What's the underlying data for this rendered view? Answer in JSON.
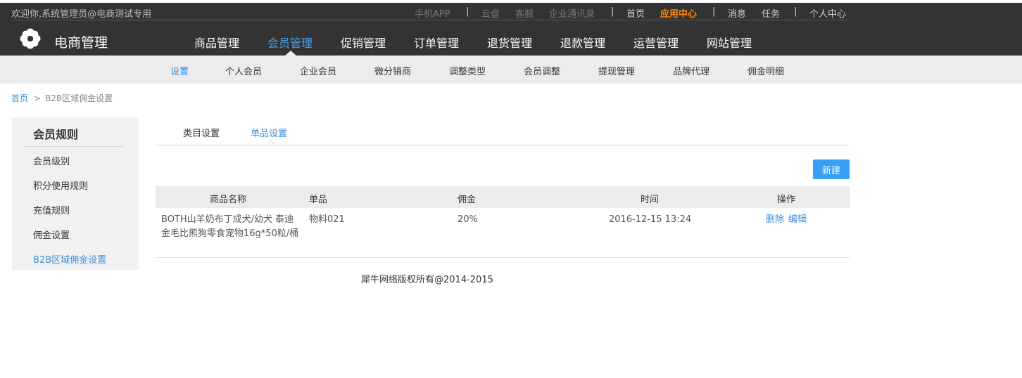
{
  "topbar": {
    "welcome": "欢迎你,系统管理员@电商测试专用",
    "links": {
      "app": "手机APP",
      "cloud": "云盘",
      "customer_service": "客服",
      "directory": "企业通讯录",
      "home": "首页",
      "app_center": "应用中心",
      "messages": "消息",
      "tasks": "任务",
      "profile": "个人中心"
    },
    "separator": "|"
  },
  "brand": {
    "name": "电商管理"
  },
  "main_nav": {
    "items": [
      "商品管理",
      "会员管理",
      "促销管理",
      "订单管理",
      "退货管理",
      "退款管理",
      "运营管理",
      "网站管理"
    ],
    "active": "会员管理"
  },
  "sub_nav": {
    "items": [
      "设置",
      "个人会员",
      "企业会员",
      "微分销商",
      "调整类型",
      "会员调整",
      "提现管理",
      "品牌代理",
      "佣金明细"
    ],
    "active": "设置"
  },
  "breadcrumb": {
    "home": "首页",
    "separator": ">",
    "current": "B2B区域佣金设置"
  },
  "sidebar": {
    "title": "会员规则",
    "items": [
      "会员级别",
      "积分使用规则",
      "充值规则",
      "佣金设置",
      "B2B区域佣金设置"
    ],
    "active": "B2B区域佣金设置"
  },
  "tabs": {
    "items": [
      "类目设置",
      "单品设置"
    ],
    "active": "单品设置"
  },
  "new_button": "新建",
  "table": {
    "headers": [
      "商品名称",
      "单品",
      "佣金",
      "时间",
      "操作"
    ],
    "rows": [
      {
        "name": "BOTH山羊奶布丁成犬/幼犬 泰迪金毛比熊狗零食宠物16g*50粒/桶",
        "sku": "物料021",
        "commission": "20%",
        "time": "2016-12-15 13:24",
        "delete": "删除",
        "edit": "编辑"
      }
    ]
  },
  "footer": "犀牛网络版权所有@2014-2015",
  "colors": {
    "header_bg": "#333333",
    "accent": "#3a8fd9",
    "highlight": "#ff8a00",
    "button": "#3a9ef5"
  }
}
